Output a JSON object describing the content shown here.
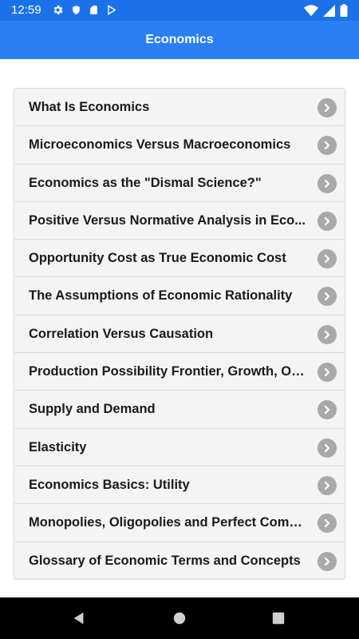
{
  "status_bar": {
    "time": "12:59",
    "icons_left": [
      "gear-icon",
      "shield-icon",
      "sd-card-icon",
      "play-store-icon"
    ],
    "icons_right": [
      "wifi-icon",
      "signal-icon",
      "battery-icon"
    ]
  },
  "app_bar": {
    "title": "Economics",
    "background": "#2a7ff2",
    "status_background": "#1b72e8"
  },
  "list": {
    "items": [
      {
        "label": "What Is Economics"
      },
      {
        "label": "Microeconomics Versus Macroeconomics"
      },
      {
        "label": "Economics as the \"Dismal Science?\""
      },
      {
        "label": "Positive Versus Normative Analysis in Eco..."
      },
      {
        "label": "Opportunity Cost as True Economic Cost"
      },
      {
        "label": "The Assumptions of Economic Rationality"
      },
      {
        "label": "Correlation Versus Causation"
      },
      {
        "label": "Production Possibility Frontier, Growth, Op..."
      },
      {
        "label": "Supply and Demand"
      },
      {
        "label": "Elasticity"
      },
      {
        "label": "Economics Basics: Utility"
      },
      {
        "label": "Monopolies, Oligopolies and Perfect Comp..."
      },
      {
        "label": "Glossary of Economic Terms and Concepts"
      }
    ],
    "item_icon": "chevron-right-icon"
  },
  "nav_bar": {
    "buttons": [
      "back-icon",
      "home-icon",
      "recents-icon"
    ]
  }
}
